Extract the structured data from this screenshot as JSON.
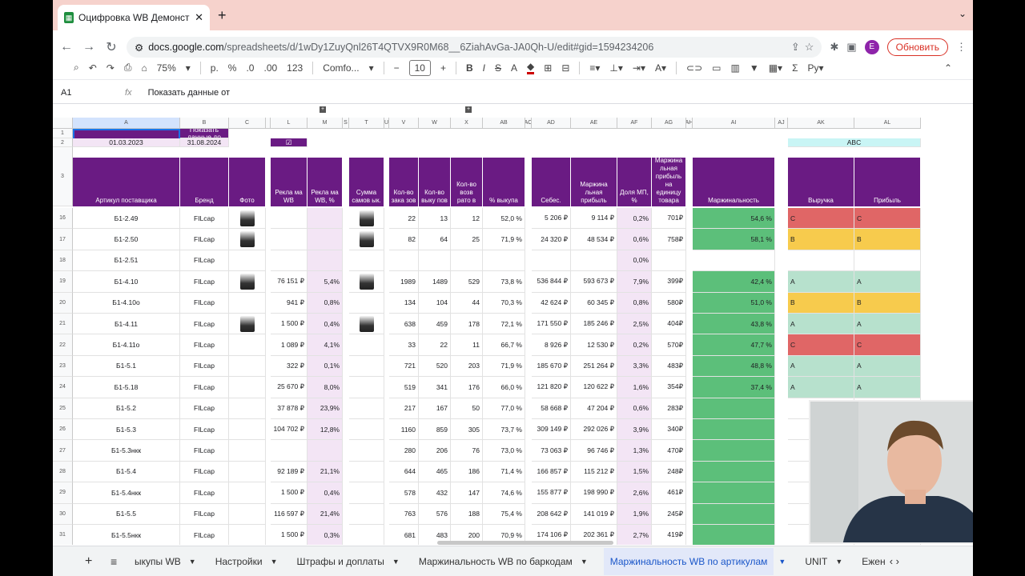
{
  "browser": {
    "tab_title": "Оцифровка WB Демонстр - G",
    "url_host": "docs.google.com",
    "url_path": "/spreadsheets/d/1wDy1ZuyQnl26T4QTVX9R0M68__6ZiahAvGa-JA0Qh-U/edit#gid=1594234206",
    "avatar_letter": "E",
    "update_label": "Обновить"
  },
  "toolbar": {
    "zoom": "75%",
    "currency": "р.",
    "percent": "%",
    "dec_minus": ".0",
    "dec_plus": ".00",
    "number_fmt": "123",
    "font": "Comfo...",
    "font_size": "10"
  },
  "formula": {
    "cell_ref": "A1",
    "fx": "fx",
    "content": "Показать данные от"
  },
  "columns": [
    "A",
    "B",
    "C",
    "L",
    "M",
    "S",
    "T",
    "U",
    "V",
    "W",
    "X",
    "AB",
    "AC",
    "AD",
    "AE",
    "AF",
    "AG",
    "AH",
    "AI",
    "AJ",
    "AK",
    "AL"
  ],
  "top": {
    "show_from": "Показать данные от",
    "show_to": "Показать данные до",
    "date_from": "01.03.2023",
    "date_to": "31.08.2024",
    "abc": "ABC"
  },
  "headers": [
    "Артикул поставщика",
    "Бренд",
    "Фото",
    "Рекла ма WB",
    "Рекла ма WB, %",
    "Сумма самов ык.",
    "Кол-во зака зов",
    "Кол-во выку пов",
    "Кол-во возв рато в",
    "% выкупа",
    "Себес.",
    "Маржина льная прибыль",
    "Доля МП, %",
    "Маржина льная прибыль на единицу товара",
    "Маржинальность",
    "Выручка",
    "Прибыль"
  ],
  "rows": [
    {
      "n": "16",
      "art": "Б1-2.49",
      "brand": "FILcap",
      "ad": "",
      "adp": "",
      "orders": "22",
      "buy": "13",
      "ret": "12",
      "pct": "52,0 %",
      "cost": "5 206 ₽",
      "mp": "9 114 ₽",
      "share": "0,2%",
      "unit": "701₽",
      "marg": "54,6 %",
      "rev": "C",
      "prof": "C"
    },
    {
      "n": "17",
      "art": "Б1-2.50",
      "brand": "FILcap",
      "ad": "",
      "adp": "",
      "orders": "82",
      "buy": "64",
      "ret": "25",
      "pct": "71,9 %",
      "cost": "24 320 ₽",
      "mp": "48 534 ₽",
      "share": "0,6%",
      "unit": "758₽",
      "marg": "58,1 %",
      "rev": "B",
      "prof": "B"
    },
    {
      "n": "18",
      "art": "Б1-2.51",
      "brand": "FILcap",
      "ad": "",
      "adp": "",
      "orders": "",
      "buy": "",
      "ret": "",
      "pct": "",
      "cost": "",
      "mp": "",
      "share": "0,0%",
      "unit": "",
      "marg": "",
      "rev": "",
      "prof": ""
    },
    {
      "n": "19",
      "art": "Б1-4.10",
      "brand": "FILcap",
      "ad": "76 151 ₽",
      "adp": "5,4%",
      "orders": "1989",
      "buy": "1489",
      "ret": "529",
      "pct": "73,8 %",
      "cost": "536 844 ₽",
      "mp": "593 673 ₽",
      "share": "7,9%",
      "unit": "399₽",
      "marg": "42,4 %",
      "rev": "A",
      "prof": "A"
    },
    {
      "n": "20",
      "art": "Б1-4.10o",
      "brand": "FILcap",
      "ad": "941 ₽",
      "adp": "0,8%",
      "orders": "134",
      "buy": "104",
      "ret": "44",
      "pct": "70,3 %",
      "cost": "42 624 ₽",
      "mp": "60 345 ₽",
      "share": "0,8%",
      "unit": "580₽",
      "marg": "51,0 %",
      "rev": "B",
      "prof": "B"
    },
    {
      "n": "21",
      "art": "Б1-4.11",
      "brand": "FILcap",
      "ad": "1 500 ₽",
      "adp": "0,4%",
      "orders": "638",
      "buy": "459",
      "ret": "178",
      "pct": "72,1 %",
      "cost": "171 550 ₽",
      "mp": "185 246 ₽",
      "share": "2,5%",
      "unit": "404₽",
      "marg": "43,8 %",
      "rev": "A",
      "prof": "A"
    },
    {
      "n": "22",
      "art": "Б1-4.11o",
      "brand": "FILcap",
      "ad": "1 089 ₽",
      "adp": "4,1%",
      "orders": "33",
      "buy": "22",
      "ret": "11",
      "pct": "66,7 %",
      "cost": "8 926 ₽",
      "mp": "12 530 ₽",
      "share": "0,2%",
      "unit": "570₽",
      "marg": "47,7 %",
      "rev": "C",
      "prof": "C"
    },
    {
      "n": "23",
      "art": "Б1-5.1",
      "brand": "FILcap",
      "ad": "322 ₽",
      "adp": "0,1%",
      "orders": "721",
      "buy": "520",
      "ret": "203",
      "pct": "71,9 %",
      "cost": "185 670 ₽",
      "mp": "251 264 ₽",
      "share": "3,3%",
      "unit": "483₽",
      "marg": "48,8 %",
      "rev": "A",
      "prof": "A"
    },
    {
      "n": "24",
      "art": "Б1-5.18",
      "brand": "FILcap",
      "ad": "25 670 ₽",
      "adp": "8,0%",
      "orders": "519",
      "buy": "341",
      "ret": "176",
      "pct": "66,0 %",
      "cost": "121 820 ₽",
      "mp": "120 622 ₽",
      "share": "1,6%",
      "unit": "354₽",
      "marg": "37,4 %",
      "rev": "A",
      "prof": "A"
    },
    {
      "n": "25",
      "art": "Б1-5.2",
      "brand": "FILcap",
      "ad": "37 878 ₽",
      "adp": "23,9%",
      "orders": "217",
      "buy": "167",
      "ret": "50",
      "pct": "77,0 %",
      "cost": "58 668 ₽",
      "mp": "47 204 ₽",
      "share": "0,6%",
      "unit": "283₽",
      "marg": "",
      "rev": "",
      "prof": ""
    },
    {
      "n": "26",
      "art": "Б1-5.3",
      "brand": "FILcap",
      "ad": "104 702 ₽",
      "adp": "12,8%",
      "orders": "1160",
      "buy": "859",
      "ret": "305",
      "pct": "73,7 %",
      "cost": "309 149 ₽",
      "mp": "292 026 ₽",
      "share": "3,9%",
      "unit": "340₽",
      "marg": "",
      "rev": "",
      "prof": ""
    },
    {
      "n": "27",
      "art": "Б1-5.3нкк",
      "brand": "FILcap",
      "ad": "",
      "adp": "",
      "orders": "280",
      "buy": "206",
      "ret": "76",
      "pct": "73,0 %",
      "cost": "73 063 ₽",
      "mp": "96 746 ₽",
      "share": "1,3%",
      "unit": "470₽",
      "marg": "",
      "rev": "",
      "prof": ""
    },
    {
      "n": "28",
      "art": "Б1-5.4",
      "brand": "FILcap",
      "ad": "92 189 ₽",
      "adp": "21,1%",
      "orders": "644",
      "buy": "465",
      "ret": "186",
      "pct": "71,4 %",
      "cost": "166 857 ₽",
      "mp": "115 212 ₽",
      "share": "1,5%",
      "unit": "248₽",
      "marg": "",
      "rev": "",
      "prof": ""
    },
    {
      "n": "29",
      "art": "Б1-5.4нкк",
      "brand": "FILcap",
      "ad": "1 500 ₽",
      "adp": "0,4%",
      "orders": "578",
      "buy": "432",
      "ret": "147",
      "pct": "74,6 %",
      "cost": "155 877 ₽",
      "mp": "198 990 ₽",
      "share": "2,6%",
      "unit": "461₽",
      "marg": "",
      "rev": "",
      "prof": ""
    },
    {
      "n": "30",
      "art": "Б1-5.5",
      "brand": "FILcap",
      "ad": "116 597 ₽",
      "adp": "21,4%",
      "orders": "763",
      "buy": "576",
      "ret": "188",
      "pct": "75,4 %",
      "cost": "208 642 ₽",
      "mp": "141 019 ₽",
      "share": "1,9%",
      "unit": "245₽",
      "marg": "",
      "rev": "",
      "prof": ""
    },
    {
      "n": "31",
      "art": "Б1-5.5нкк",
      "brand": "FILcap",
      "ad": "1 500 ₽",
      "adp": "0,3%",
      "orders": "681",
      "buy": "483",
      "ret": "200",
      "pct": "70,9 %",
      "cost": "174 106 ₽",
      "mp": "202 361 ₽",
      "share": "2,7%",
      "unit": "419₽",
      "marg": "",
      "rev": "",
      "prof": ""
    }
  ],
  "sheets": [
    "ыкупы WB",
    "Настройки",
    "Штрафы и доплаты",
    "Маржинальность WB по баркодам",
    "Маржинальность WB по артикулам",
    "UNIT",
    "Ежене"
  ],
  "colors": {
    "purple": "#6a1b83",
    "green": "#5cbf7a",
    "light_green": "#b7e1cd",
    "yellow": "#f7cb4d",
    "red": "#e06666",
    "tint": "#f3e5f5"
  }
}
